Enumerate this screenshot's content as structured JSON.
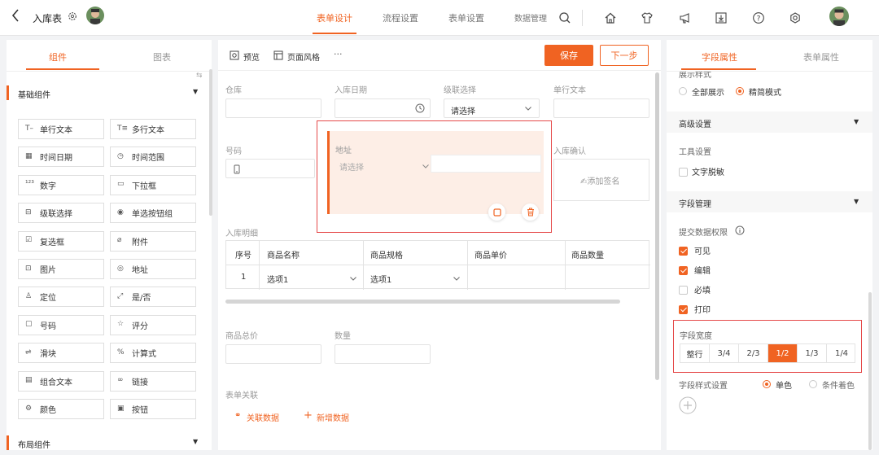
{
  "header": {
    "back_icon": "chevron-left-icon",
    "title": "入库表",
    "settings_icon": "gear-icon",
    "nav": [
      "表单设计",
      "流程设置",
      "表单设置",
      "数据管理"
    ],
    "active_nav": "表单设计",
    "tool_icons": [
      "search-icon",
      "home-icon",
      "shirt-icon",
      "megaphone-icon",
      "download-icon",
      "help-icon",
      "gear-icon"
    ]
  },
  "left": {
    "tabs": [
      "组件",
      "图表"
    ],
    "section_basic": "基础组件",
    "components": [
      [
        "单行文本",
        "多行文本"
      ],
      [
        "时间日期",
        "时间范围"
      ],
      [
        "数字",
        "下拉框"
      ],
      [
        "级联选择",
        "单选按钮组"
      ],
      [
        "复选框",
        "附件"
      ],
      [
        "图片",
        "地址"
      ],
      [
        "定位",
        "是/否"
      ],
      [
        "号码",
        "评分"
      ],
      [
        "滑块",
        "计算式"
      ],
      [
        "组合文本",
        "链接"
      ],
      [
        "颜色",
        "按钮"
      ]
    ],
    "component_icons": [
      "T–",
      "T≡",
      "▦",
      "◷",
      "¹²³",
      "▭",
      "⊟",
      "◉",
      "☑",
      "⌀",
      "⊡",
      "◎",
      "♙",
      "⤢",
      "▢",
      "☆",
      "⇌",
      "%",
      "▤",
      "∞",
      "⚙",
      "▣"
    ],
    "section_layout": "布局组件"
  },
  "toolbar": {
    "preview": "预览",
    "style": "页面风格",
    "more": "···",
    "save": "保存",
    "next": "下一步"
  },
  "form": {
    "warehouse": "仓库",
    "in_date": "入库日期",
    "cascade": "级联选择",
    "cascade_placeholder": "请选择",
    "single_text": "单行文本",
    "number_label": "号码",
    "address": "地址",
    "address_placeholder": "请选择",
    "confirm": "入库确认",
    "add_signature": "✍添加签名",
    "detail_title": "入库明细",
    "table_headers": [
      "序号",
      "商品名称",
      "商品规格",
      "商品单价",
      "商品数量"
    ],
    "table_row": {
      "index": "1",
      "name": "选项1",
      "spec": "选项1"
    },
    "total_price": "商品总价",
    "quantity": "数量",
    "relation": "表单关联",
    "link_data": "关联数据",
    "add_data": "新增数据"
  },
  "right": {
    "tabs": [
      "字段属性",
      "表单属性"
    ],
    "display_style": "展示样式",
    "display_options": [
      "全部展示",
      "精简模式"
    ],
    "display_selected": "精简模式",
    "advanced": "高级设置",
    "tool_settings": "工具设置",
    "desensitize": "文字脱敏",
    "field_mgmt": "字段管理",
    "permission_title": "提交数据权限",
    "permissions": [
      {
        "label": "可见",
        "checked": true
      },
      {
        "label": "编辑",
        "checked": true
      },
      {
        "label": "必填",
        "checked": false
      },
      {
        "label": "打印",
        "checked": true
      }
    ],
    "width_title": "字段宽度",
    "widths": [
      "整行",
      "3/4",
      "2/3",
      "1/2",
      "1/3",
      "1/4"
    ],
    "width_selected": "1/2",
    "style_title": "字段样式设置",
    "style_options": [
      "单色",
      "条件着色"
    ],
    "style_selected": "单色"
  },
  "colors": {
    "accent": "#f06322",
    "accent_light": "#fdeee6",
    "highlight_border": "#e54a4a"
  }
}
